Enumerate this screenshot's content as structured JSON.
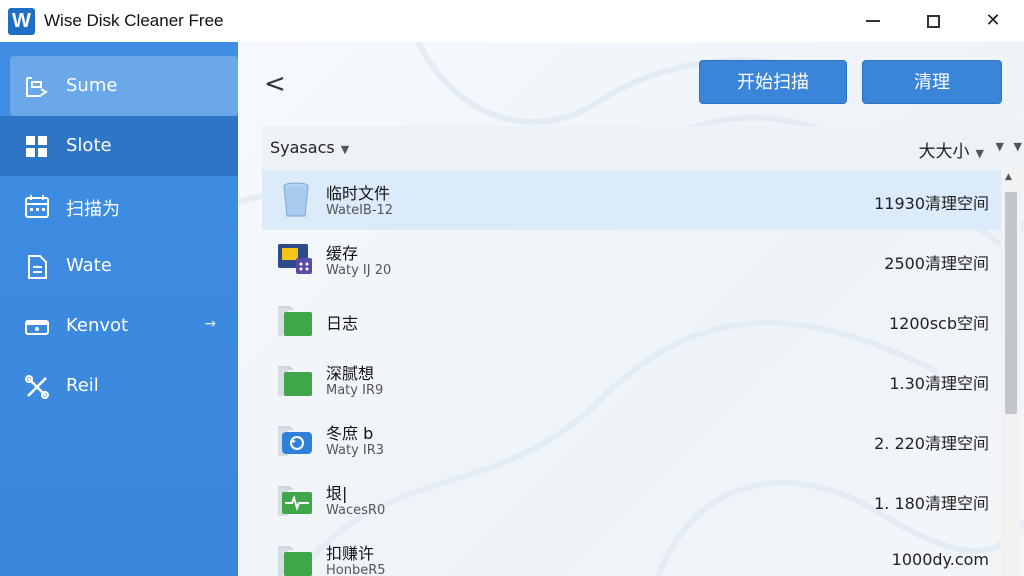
{
  "app": {
    "title": "Wise Disk Cleaner Free",
    "logo_letter": "W"
  },
  "window_controls": {
    "minimize": "minimize",
    "maximize": "maximize",
    "close": "✕"
  },
  "sidebar": {
    "items": [
      {
        "label": "Sume",
        "icon": "sweep-icon",
        "selected": true
      },
      {
        "label": "Slote",
        "icon": "grid-icon",
        "selected": false
      },
      {
        "label": "扫描为",
        "icon": "calendar-icon",
        "selected": false
      },
      {
        "label": "Wate",
        "icon": "document-icon",
        "selected": false
      },
      {
        "label": "Kenvot",
        "icon": "drive-icon",
        "selected": false,
        "arrow": "→"
      },
      {
        "label": "Reil",
        "icon": "tools-icon",
        "selected": false
      }
    ]
  },
  "toolbar": {
    "back": "<",
    "scan_label": "开始扫描",
    "clean_label": "清理"
  },
  "list": {
    "header": {
      "name": "Syasacs",
      "size": "大大小"
    },
    "rows": [
      {
        "name": "临时文件",
        "sub": "WateIB-12",
        "size": "11930清理空间",
        "icon": "recycle-bin-icon",
        "selected": true
      },
      {
        "name": "缓存",
        "sub": "Waty IJ 20",
        "size": "2500清理空间",
        "icon": "cache-icon",
        "selected": false
      },
      {
        "name": "日志",
        "sub": "",
        "size": "1200scb空间",
        "icon": "folder-icon",
        "selected": false
      },
      {
        "name": "深腻想",
        "sub": "Maty IR9",
        "size": "1.30清理空间",
        "icon": "folder-icon",
        "selected": false
      },
      {
        "name": "冬庶 b",
        "sub": "Waty IR3",
        "size": "2. 220清理空间",
        "icon": "restore-icon",
        "selected": false
      },
      {
        "name": "垠|",
        "sub": "WacesR0",
        "size": "1. 180清理空间",
        "icon": "diagnostic-icon",
        "selected": false
      },
      {
        "name": "扣赚许",
        "sub": "HonbeR5",
        "size": "1000dy.com",
        "icon": "folder-icon",
        "selected": false
      }
    ]
  },
  "colors": {
    "sidebar": "#3f8ee3",
    "accent": "#3a85d8",
    "selected_row": "#dcebfa"
  }
}
